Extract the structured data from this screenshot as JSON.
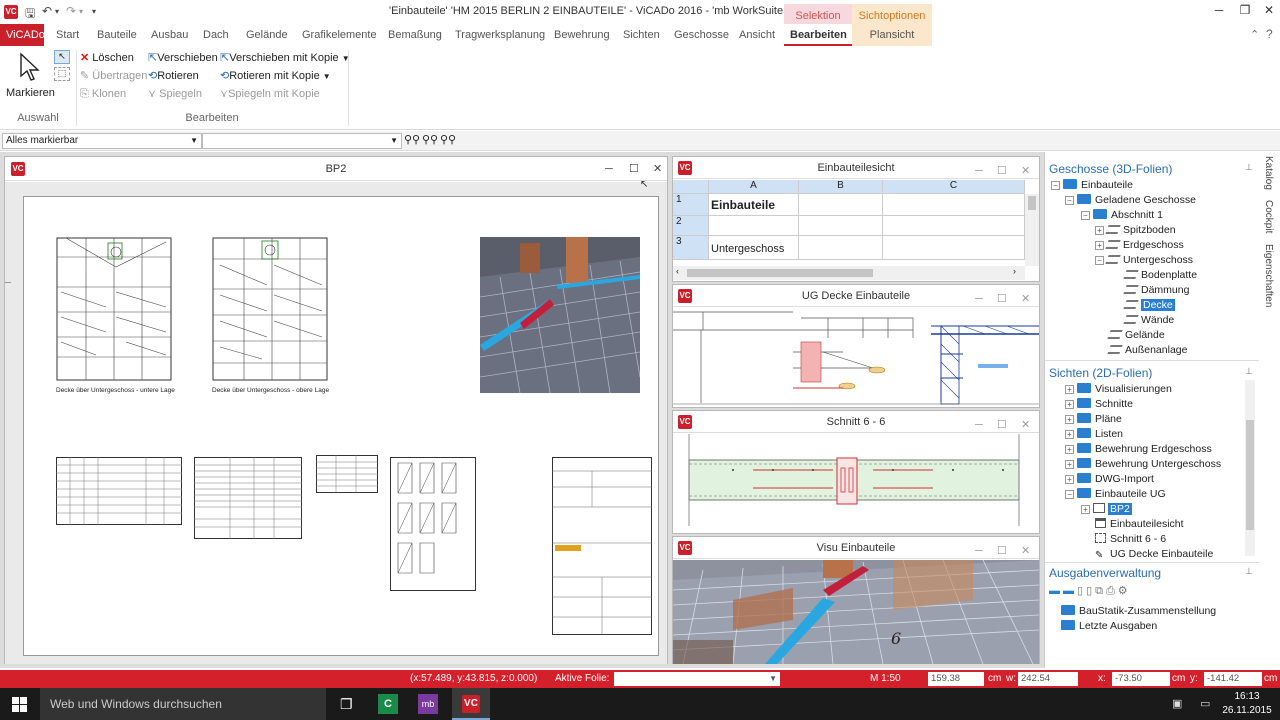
{
  "window": {
    "title": "'Einbauteile' 'HM 2015 BERLIN 2 EINBAUTEILE' - ViCADo 2016 - 'mb WorkSuite 2016 (Kd.-Nr. 60000)'"
  },
  "tabs": {
    "app": "ViCADo",
    "items": [
      "Start",
      "Bauteile",
      "Ausbau",
      "Dach",
      "Gelände",
      "Grafikelemente",
      "Bemaßung",
      "Tragwerksplanung",
      "Bewehrung",
      "Sichten",
      "Geschosse",
      "Ansicht",
      "Bearbeiten",
      "Plansicht"
    ],
    "context_selektion": "Selektion",
    "context_sichtoptionen": "Sichtoptionen",
    "active": "Bearbeiten"
  },
  "ribbon": {
    "markieren": "Markieren",
    "auswahl_group": "Auswahl",
    "loeschen": "Löschen",
    "uebertragen": "Übertragen",
    "klonen": "Klonen",
    "verschieben": "Verschieben",
    "rotieren": "Rotieren",
    "spiegeln": "Spiegeln",
    "verschieben_kopie": "Verschieben mit Kopie",
    "rotieren_kopie": "Rotieren mit Kopie",
    "spiegeln_kopie": "Spiegeln mit Kopie",
    "bearbeiten_group": "Bearbeiten"
  },
  "filter": {
    "selection": "Alles markierbar",
    "second": ""
  },
  "bp2": {
    "title": "BP2",
    "caption1": "Decke über Untergeschoss - untere Lage",
    "caption2": "Decke über Untergeschoss - obere Lage"
  },
  "sheet": {
    "title": "Einbauteilesicht",
    "columns": [
      "A",
      "B",
      "C"
    ],
    "rows": [
      "1",
      "2",
      "3"
    ],
    "a1": "Einbauteile",
    "a3": "Untergeschoss"
  },
  "view_ug": {
    "title": "UG Decke Einbauteile"
  },
  "view_schnitt": {
    "title": "Schnitt 6 - 6"
  },
  "view_visu": {
    "title": "Visu Einbauteile",
    "label": "6"
  },
  "geschosse": {
    "header": "Geschosse (3D-Folien)",
    "items": [
      "Einbauteile",
      "Geladene Geschosse",
      "Abschnitt 1",
      "Spitzboden",
      "Erdgeschoss",
      "Untergeschoss",
      "Bodenplatte",
      "Dämmung",
      "Decke",
      "Wände",
      "Gelände",
      "Außenanlage"
    ]
  },
  "sichten": {
    "header": "Sichten (2D-Folien)",
    "items": [
      "Visualisierungen",
      "Schnitte",
      "Pläne",
      "Listen",
      "Bewehrung Erdgeschoss",
      "Bewehrung Untergeschoss",
      "DWG-Import",
      "Einbauteile UG",
      "BP2",
      "Einbauteilesicht",
      "Schnitt 6 - 6",
      "UG Decke Einbauteile"
    ]
  },
  "ausgaben": {
    "header": "Ausgabenverwaltung",
    "items": [
      "BauStatik-Zusammenstellung",
      "Letzte Ausgaben"
    ]
  },
  "side_tabs": [
    "Katalog",
    "Cockpit",
    "Eigenschaften"
  ],
  "status": {
    "coords": "(x:57.489, y:43.815, z:0.000)",
    "folie_label": "Aktive Folie:",
    "scale": "M 1:50",
    "v1": "159.38",
    "u1": "cm",
    "w_label": "w:",
    "v2": "242.54",
    "x_label": "x:",
    "v3": "-73.50",
    "u3": "cm",
    "y_label": "y:",
    "v4": "-141.42",
    "u4": "cm"
  },
  "taskbar": {
    "search": "Web und Windows durchsuchen",
    "time": "16:13",
    "date": "26.11.2015"
  },
  "colors": {
    "brand": "#c9202b",
    "accent": "#2b6cb0",
    "selected": "#2a7fd0"
  }
}
